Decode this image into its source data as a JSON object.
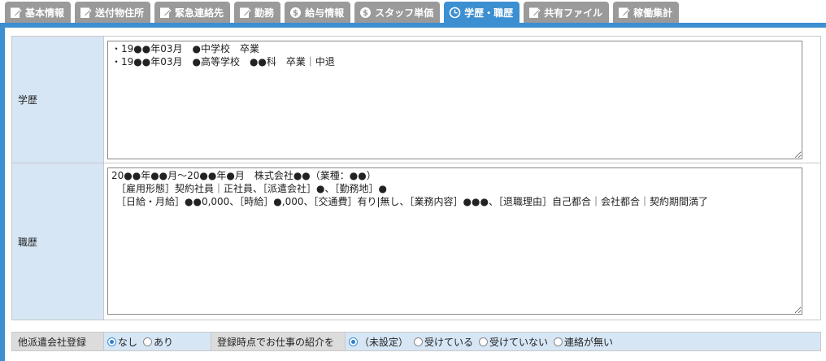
{
  "tabs": [
    {
      "label": "基本情報",
      "icon": "edit-icon",
      "active": false
    },
    {
      "label": "送付物住所",
      "icon": "edit-icon",
      "active": false
    },
    {
      "label": "緊急連絡先",
      "icon": "edit-icon",
      "active": false
    },
    {
      "label": "勤務",
      "icon": "edit-icon",
      "active": false
    },
    {
      "label": "給与情報",
      "icon": "dollar-icon",
      "active": false
    },
    {
      "label": "スタッフ単価",
      "icon": "dollar-icon",
      "active": false
    },
    {
      "label": "学歴・職歴",
      "icon": "clock-icon",
      "active": true
    },
    {
      "label": "共有ファイル",
      "icon": "edit-icon",
      "active": false
    },
    {
      "label": "稼働集計",
      "icon": "edit-icon",
      "active": false
    }
  ],
  "education": {
    "label": "学歴",
    "value": "・19●●年03月　●中学校　卒業\n・19●●年03月　●高等学校　●●科　卒業｜中退"
  },
  "career": {
    "label": "職歴",
    "value": "20●●年●●月～20●●年●月　株式会社●●（業種：●●）\n　［雇用形態］契約社員｜正社員、［派遣会社］●、［勤務地］●\n　［日給・月給］●●0,000、［時給］●,000、［交通費］有り|無し、［業務内容］●●●、［退職理由］自己都合｜会社都合｜契約期間満了"
  },
  "other_agency": {
    "label": "他派遣会社登録",
    "options": [
      {
        "label": "なし",
        "selected": true
      },
      {
        "label": "あり",
        "selected": false
      }
    ]
  },
  "job_intro": {
    "label": "登録時点でお仕事の紹介を",
    "options": [
      {
        "label": "（未設定）",
        "selected": true
      },
      {
        "label": "受けている",
        "selected": false
      },
      {
        "label": "受けていない",
        "selected": false
      },
      {
        "label": "連絡が無い",
        "selected": false
      }
    ]
  },
  "colors": {
    "accent": "#3c8fd1",
    "tab_inactive": "#9a9a9a",
    "label_bg": "#d6e6f5"
  }
}
